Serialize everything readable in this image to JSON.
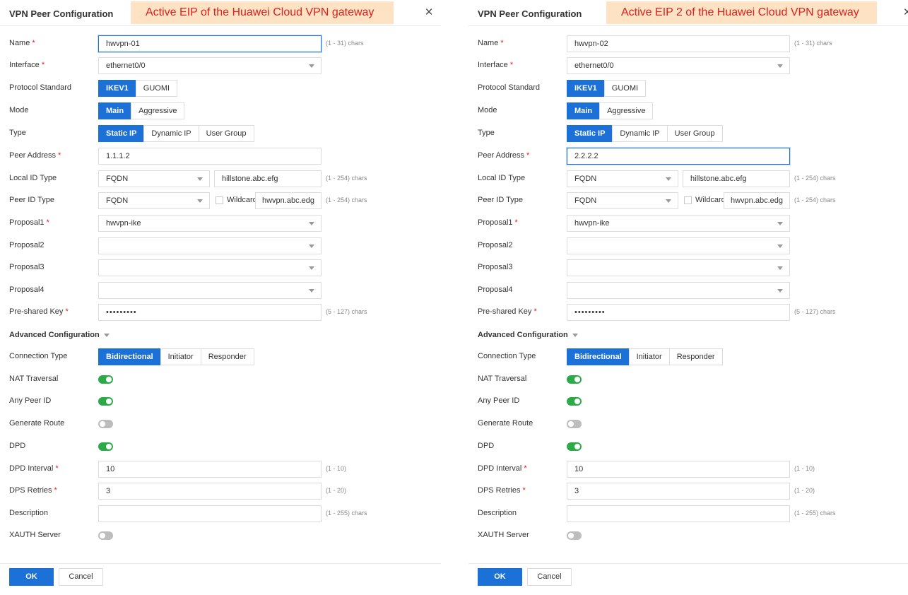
{
  "labels": {
    "title": "VPN Peer Configuration",
    "name": "Name",
    "interface": "Interface",
    "protocol_standard": "Protocol Standard",
    "mode": "Mode",
    "type": "Type",
    "peer_address": "Peer Address",
    "local_id_type": "Local ID Type",
    "peer_id_type": "Peer ID Type",
    "proposal1": "Proposal1",
    "proposal2": "Proposal2",
    "proposal3": "Proposal3",
    "proposal4": "Proposal4",
    "pre_shared_key": "Pre-shared Key",
    "advanced": "Advanced Configuration",
    "connection_type": "Connection Type",
    "nat_traversal": "NAT Traversal",
    "any_peer_id": "Any Peer ID",
    "generate_route": "Generate Route",
    "dpd": "DPD",
    "dpd_interval": "DPD Interval",
    "dps_retries": "DPS Retries",
    "description": "Description",
    "xauth_server": "XAUTH Server",
    "wildcard": "Wildcard",
    "required_mark": "*"
  },
  "hints": {
    "name": "(1 - 31) chars",
    "local_id": "(1 - 254) chars",
    "peer_id": "(1 - 254) chars",
    "psk": "(5 - 127) chars",
    "dpd_interval": "(1 - 10)",
    "dps_retries": "(1 - 20)",
    "description": "(1 - 255) chars"
  },
  "options": {
    "protocol": [
      "IKEV1",
      "GUOMI"
    ],
    "mode": [
      "Main",
      "Aggressive"
    ],
    "type": [
      "Static IP",
      "Dynamic IP",
      "User Group"
    ],
    "connection": [
      "Bidirectional",
      "Initiator",
      "Responder"
    ]
  },
  "buttons": {
    "ok": "OK",
    "cancel": "Cancel"
  },
  "icons": {
    "close": "close-icon",
    "dropdown": "chevron-down-icon"
  },
  "colors": {
    "primary": "#1c71d8",
    "toggle_on": "#2bab48",
    "toggle_off": "#bdbdbd",
    "banner_bg": "#fde2c4",
    "banner_text": "#e0201b",
    "required": "#e0201b"
  },
  "dialogs": {
    "left": {
      "banner": "Active EIP of the Huawei Cloud VPN gateway",
      "name": "hwvpn-01",
      "interface": "ethernet0/0",
      "protocol_selected": "IKEV1",
      "mode_selected": "Main",
      "type_selected": "Static IP",
      "peer_address": "1.1.1.2",
      "local_id_type": "FQDN",
      "local_id_value": "hillstone.abc.efg",
      "peer_id_type": "FQDN",
      "wildcard_checked": false,
      "peer_id_value": "hwvpn.abc.edg",
      "proposal1": "hwvpn-ike",
      "proposal2": "",
      "proposal3": "",
      "proposal4": "",
      "psk_masked": "•••••••••",
      "connection_selected": "Bidirectional",
      "nat_traversal": true,
      "any_peer_id": true,
      "generate_route": false,
      "dpd": true,
      "dpd_interval": "10",
      "dps_retries": "3",
      "description": "",
      "xauth_server": false
    },
    "right": {
      "banner": "Active EIP 2 of the Huawei Cloud VPN gateway",
      "name": "hwvpn-02",
      "interface": "ethernet0/0",
      "protocol_selected": "IKEV1",
      "mode_selected": "Main",
      "type_selected": "Static IP",
      "peer_address": "2.2.2.2",
      "local_id_type": "FQDN",
      "local_id_value": "hillstone.abc.efg",
      "peer_id_type": "FQDN",
      "wildcard_checked": false,
      "peer_id_value": "hwvpn.abc.edg",
      "proposal1": "hwvpn-ike",
      "proposal2": "",
      "proposal3": "",
      "proposal4": "",
      "psk_masked": "•••••••••",
      "connection_selected": "Bidirectional",
      "nat_traversal": true,
      "any_peer_id": true,
      "generate_route": false,
      "dpd": true,
      "dpd_interval": "10",
      "dps_retries": "3",
      "description": "",
      "xauth_server": false
    }
  }
}
